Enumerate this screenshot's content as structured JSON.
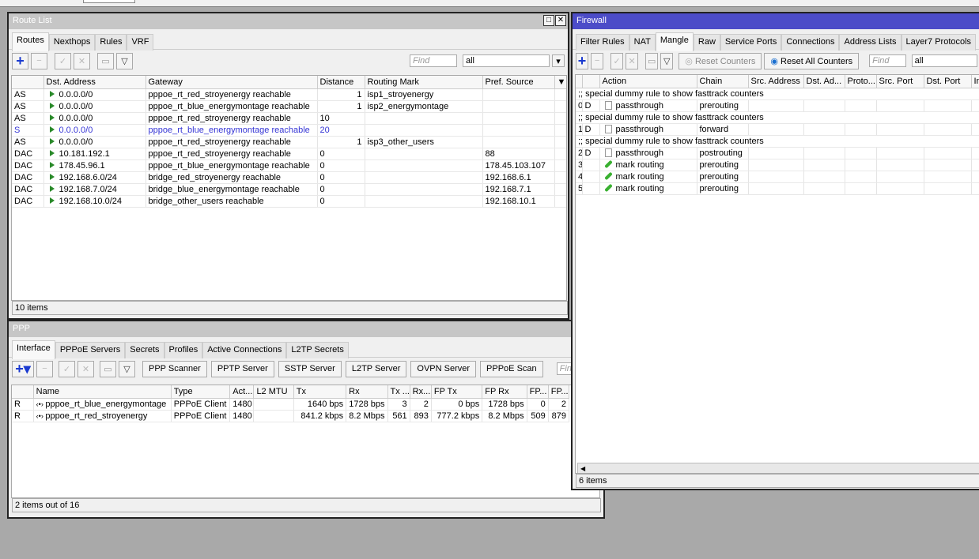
{
  "route_list": {
    "title": "Route List",
    "tabs": [
      "Routes",
      "Nexthops",
      "Rules",
      "VRF"
    ],
    "find_placeholder": "Find",
    "filter_value": "all",
    "columns": [
      "",
      "Dst. Address",
      "Gateway",
      "Distance",
      "Routing Mark",
      "Pref. Source"
    ],
    "rows": [
      {
        "flag": "AS",
        "dst": "0.0.0.0/0",
        "gw": "pppoe_rt_red_stroyenergy reachable",
        "dist": "1",
        "mark": "isp1_stroyenergy",
        "src": "",
        "right": true
      },
      {
        "flag": "AS",
        "dst": "0.0.0.0/0",
        "gw": "pppoe_rt_blue_energymontage reachable",
        "dist": "1",
        "mark": "isp2_energymontage",
        "src": "",
        "right": true
      },
      {
        "flag": "AS",
        "dst": "0.0.0.0/0",
        "gw": "pppoe_rt_red_stroyenergy reachable",
        "dist": "10",
        "mark": "",
        "src": "",
        "right": false
      },
      {
        "flag": "S",
        "dst": "0.0.0.0/0",
        "gw": "pppoe_rt_blue_energymontage reachable",
        "dist": "20",
        "mark": "",
        "src": "",
        "right": false,
        "inactive": true
      },
      {
        "flag": "AS",
        "dst": "0.0.0.0/0",
        "gw": "pppoe_rt_red_stroyenergy reachable",
        "dist": "1",
        "mark": "isp3_other_users",
        "src": "",
        "right": true
      },
      {
        "flag": "DAC",
        "dst": "10.181.192.1",
        "gw": "pppoe_rt_red_stroyenergy reachable",
        "dist": "0",
        "mark": "",
        "src": "88",
        "right": false
      },
      {
        "flag": "DAC",
        "dst": "178.45.96.1",
        "gw": "pppoe_rt_blue_energymontage reachable",
        "dist": "0",
        "mark": "",
        "src": "178.45.103.107",
        "right": false
      },
      {
        "flag": "DAC",
        "dst": "192.168.6.0/24",
        "gw": "bridge_red_stroyenergy reachable",
        "dist": "0",
        "mark": "",
        "src": "192.168.6.1",
        "right": false
      },
      {
        "flag": "DAC",
        "dst": "192.168.7.0/24",
        "gw": "bridge_blue_energymontage reachable",
        "dist": "0",
        "mark": "",
        "src": "192.168.7.1",
        "right": false
      },
      {
        "flag": "DAC",
        "dst": "192.168.10.0/24",
        "gw": "bridge_other_users reachable",
        "dist": "0",
        "mark": "",
        "src": "192.168.10.1",
        "right": false
      }
    ],
    "status": "10 items"
  },
  "ppp": {
    "title": "PPP",
    "tabs": [
      "Interface",
      "PPPoE Servers",
      "Secrets",
      "Profiles",
      "Active Connections",
      "L2TP Secrets"
    ],
    "buttons": [
      "PPP Scanner",
      "PPTP Server",
      "SSTP Server",
      "L2TP Server",
      "OVPN Server",
      "PPPoE Scan"
    ],
    "find_placeholder": "Find",
    "columns": [
      "",
      "Name",
      "Type",
      "Act...",
      "L2 MTU",
      "Tx",
      "Rx",
      "Tx ...",
      "Rx...",
      "FP Tx",
      "FP Rx",
      "FP...",
      "FP..."
    ],
    "rows": [
      [
        "R",
        "pppoe_rt_blue_energymontage",
        "PPPoE Client",
        "1480",
        "",
        "1640 bps",
        "1728 bps",
        "3",
        "2",
        "0 bps",
        "1728 bps",
        "0",
        "2"
      ],
      [
        "R",
        "pppoe_rt_red_stroyenergy",
        "PPPoE Client",
        "1480",
        "",
        "841.2 kbps",
        "8.2 Mbps",
        "561",
        "893",
        "777.2 kbps",
        "8.2 Mbps",
        "509",
        "879"
      ]
    ],
    "status": "2 items out of 16"
  },
  "firewall": {
    "title": "Firewall",
    "tabs": [
      "Filter Rules",
      "NAT",
      "Mangle",
      "Raw",
      "Service Ports",
      "Connections",
      "Address Lists",
      "Layer7 Protocols"
    ],
    "reset_counters": "Reset Counters",
    "reset_all_counters": "Reset All Counters",
    "find_placeholder": "Find",
    "filter_value": "all",
    "columns": [
      "",
      "",
      "Action",
      "Chain",
      "Src. Address",
      "Dst. Ad...",
      "Proto...",
      "Src. Port",
      "Dst. Port",
      "In"
    ],
    "rows": [
      {
        "comment": ";; special dummy rule to show fasttrack counters"
      },
      {
        "num": "0",
        "flag": "D",
        "action": "passthrough",
        "icon": "doc",
        "chain": "prerouting"
      },
      {
        "comment": ";; special dummy rule to show fasttrack counters"
      },
      {
        "num": "1",
        "flag": "D",
        "action": "passthrough",
        "icon": "doc",
        "chain": "forward"
      },
      {
        "comment": ";; special dummy rule to show fasttrack counters"
      },
      {
        "num": "2",
        "flag": "D",
        "action": "passthrough",
        "icon": "doc",
        "chain": "postrouting"
      },
      {
        "num": "3",
        "flag": "",
        "action": "mark routing",
        "icon": "pencil",
        "chain": "prerouting"
      },
      {
        "num": "4",
        "flag": "",
        "action": "mark routing",
        "icon": "pencil",
        "chain": "prerouting"
      },
      {
        "num": "5",
        "flag": "",
        "action": "mark routing",
        "icon": "pencil",
        "chain": "prerouting"
      }
    ],
    "status": "6 items",
    "title_color": "#4c4cc8"
  }
}
